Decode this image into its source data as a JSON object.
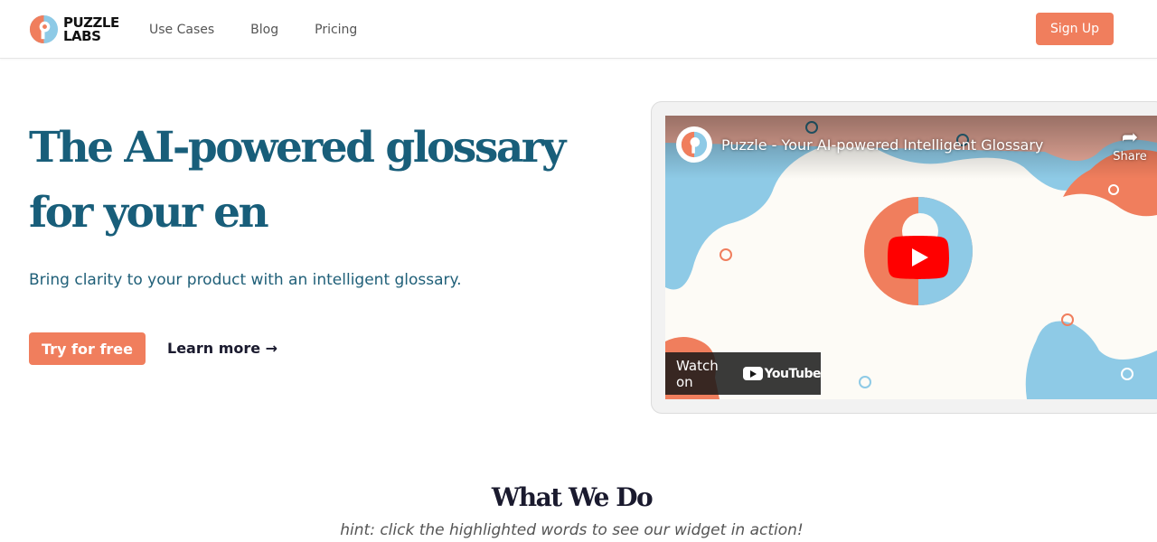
{
  "brand": {
    "logo_line1": "PUZZLE",
    "logo_line2": "LABS",
    "accent": "#f07e5d",
    "primary": "#185e7a",
    "secondary": "#8ecae6"
  },
  "nav": {
    "items": [
      {
        "label": "Use Cases"
      },
      {
        "label": "Blog"
      },
      {
        "label": "Pricing"
      }
    ],
    "signup_label": "Sign Up"
  },
  "hero": {
    "title": "The AI-powered glossary for your en",
    "subtitle": "Bring clarity to your product with an intelligent glossary.",
    "cta_primary": "Try for free",
    "cta_secondary": "Learn more →"
  },
  "video": {
    "title": "Puzzle - Your AI-powered Intelligent Glossary",
    "share_label": "Share",
    "watch_on_label": "Watch on",
    "youtube_label": "YouTube",
    "icons": [
      "share-icon",
      "play-icon",
      "youtube-icon"
    ]
  },
  "section": {
    "title": "What We Do",
    "hint": "hint: click the highlighted words to see our widget in action!"
  }
}
